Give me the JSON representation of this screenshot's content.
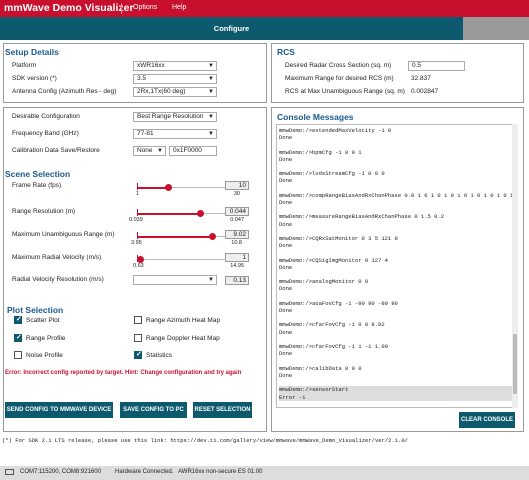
{
  "app": {
    "title": "mmWave Demo Visualizer",
    "menu": [
      "Options",
      "Help"
    ]
  },
  "tab": {
    "label": "Configure"
  },
  "setup": {
    "heading": "Setup Details",
    "platform_label": "Platform",
    "platform_value": "xWR16xx",
    "sdk_label": "SDK version (*)",
    "sdk_value": "3.5",
    "antenna_label": "Antenna Config (Azimuth Res - deg)",
    "antenna_value": "2Rx,1Tx(60 deg)"
  },
  "rcs": {
    "heading": "RCS",
    "cross_label": "Desired Radar Cross Section (sq. m)",
    "cross_value": "0.5",
    "maxrange_label": "Maximum Range for desired RCS (m)",
    "maxrange_value": "32.837",
    "rcs_label": "RCS at Max Unambiguous Range (sq. m)",
    "rcs_value": "0.002847"
  },
  "config": {
    "desirable_label": "Desirable Configuration",
    "desirable_value": "Best Range Resolution",
    "freq_label": "Frequency Band (GHz)",
    "freq_value": "77-81",
    "calib_label": "Calibration Data Save/Restore",
    "calib_value": "None",
    "calib_addr": "0x1F0000"
  },
  "scene": {
    "heading": "Scene Selection",
    "sliders": [
      {
        "label": "Frame Rate (fps)",
        "min": "1",
        "max": "30",
        "value": "10",
        "fraction": 0.31
      },
      {
        "label": "Range Resolution (m)",
        "min": "0.039",
        "max": "0.047",
        "value": "0.044",
        "fraction": 0.62
      },
      {
        "label": "Maximum Unambiguous Range (m)",
        "min": "3.95",
        "max": "10.8",
        "value": "9.02",
        "fraction": 0.74
      },
      {
        "label": "Maximum Radial Velocity (m/s)",
        "min": "0.63",
        "max": "14.95",
        "value": "1",
        "fraction": 0.03
      },
      {
        "label": "Radial Velocity Resolution (m/s)",
        "value": "0.13"
      }
    ]
  },
  "plot": {
    "heading": "Plot Selection",
    "options": [
      {
        "label": "Scatter Plot",
        "checked": true
      },
      {
        "label": "Range Azimuth Heat Map",
        "checked": false
      },
      {
        "label": "Range Profile",
        "checked": true
      },
      {
        "label": "Range Doppler Heat Map",
        "checked": false
      },
      {
        "label": "Noise Profile",
        "checked": false
      },
      {
        "label": "Statistics",
        "checked": true
      }
    ]
  },
  "error": "Error: Incorrect config reported by target. Hint: Change configuration and try again",
  "buttons": {
    "send": "SEND CONFIG TO MMWAVE DEVICE",
    "save": "SAVE CONFIG TO PC",
    "reset": "RESET SELECTION",
    "clear": "CLEAR CONSOLE"
  },
  "console": {
    "heading": "Console Messages",
    "lines": [
      "mmwDemo:/>extendedMaxVelocity -1 0",
      "Done",
      "",
      "mmwDemo:/>bpmCfg -1 0 0 1",
      "Done",
      "",
      "mmwDemo:/>lvdsStreamCfg -1 0 0 0",
      "Done",
      "",
      "mmwDemo:/>compRangeBiasAndRxChanPhase 0.0 1 0 1 0 1 0 1 0 1 0 1 0 1 0 1 0",
      "Done",
      "",
      "mmwDemo:/>measureRangeBiasAndRxChanPhase 0 1.5 0.2",
      "Done",
      "",
      "mmwDemo:/>CQRxSatMonitor 0 3 5 121 0",
      "Done",
      "",
      "mmwDemo:/>CQSigImgMonitor 0 127 4",
      "Done",
      "",
      "mmwDemo:/>analogMonitor 0 0",
      "Done",
      "",
      "mmwDemo:/>aoaFovCfg -1 -90 90 -90 90",
      "Done",
      "",
      "mmwDemo:/>cfarFovCfg -1 0 0 8.92",
      "Done",
      "",
      "mmwDemo:/>cfarFovCfg -1 1 -1 1.00",
      "Done",
      "",
      "mmwDemo:/>calibData 0 0 0",
      "Done",
      "",
      "mmwDemo:/>sensorStart",
      "Error -1"
    ]
  },
  "footnote": "(*) For SDK 2.1 LTS release, please use this link: https://dev.ti.com/gallery/view/mmwave/mmWave_Demo_Visualizer/ver/2.1.0/",
  "status": {
    "ports": "COM7:115200, COM8:921600",
    "connected": "Hardware Connected.",
    "device": "AWR16xx non-secure ES 01.00"
  }
}
